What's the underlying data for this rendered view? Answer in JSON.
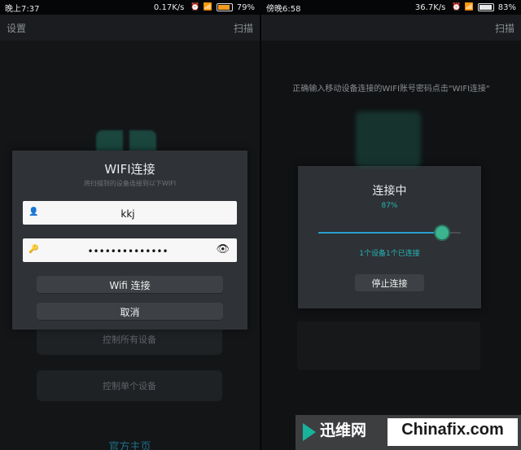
{
  "left": {
    "status": {
      "time": "晚上7:37",
      "net": "0.17K/s",
      "battery": "79%"
    },
    "actionbar": {
      "left": "设置",
      "right": "扫描"
    },
    "dialog": {
      "title": "WIFI连接",
      "subtitle": "将扫描到的设备连接到以下WIFI",
      "ssid": "kkj",
      "password": "••••••••••••••",
      "connect": "Wifi 连接",
      "cancel": "取消"
    },
    "bg_buttons": [
      "控制所有设备",
      "控制单个设备"
    ],
    "bg_link": "官方主页"
  },
  "right": {
    "status": {
      "time": "傍晚6:58",
      "net": "36.7K/s",
      "battery": "83%"
    },
    "actionbar": {
      "right": "扫描"
    },
    "hint": "正确输入移动设备连接的WIFI账号密码点击\"WIFI连接\"",
    "dialog": {
      "title": "连接中",
      "percent": "87%",
      "progress": 0.87,
      "status": "1个设备1个已连接",
      "stop": "停止连接"
    }
  },
  "watermark": {
    "cn": "迅维网",
    "en": "Chinafix.com"
  },
  "colors": {
    "accent": "#25b5b7",
    "brand": "#19b29d"
  }
}
